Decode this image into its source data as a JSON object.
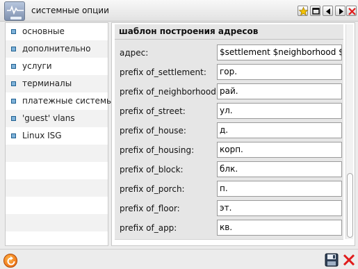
{
  "window": {
    "title": "системные опции"
  },
  "titlebar_buttons": [
    {
      "name": "favorite-star-button",
      "icon": "star-icon"
    },
    {
      "name": "maximize-button",
      "icon": "maximize-icon"
    },
    {
      "name": "previous-button",
      "icon": "arrow-left-icon"
    },
    {
      "name": "next-button",
      "icon": "arrow-right-icon"
    },
    {
      "name": "close-window-button",
      "icon": "close-icon"
    }
  ],
  "nav": {
    "items": [
      {
        "label": "основные"
      },
      {
        "label": "дополнительно"
      },
      {
        "label": "услуги"
      },
      {
        "label": "терминалы"
      },
      {
        "label": "платежные системы"
      },
      {
        "label": "'guest' vlans"
      },
      {
        "label": "Linux ISG"
      }
    ]
  },
  "section": {
    "title": "шаблон построения адресов"
  },
  "fields": [
    {
      "label": "адрес:",
      "value": "$settlement $neighborhood $lan"
    },
    {
      "label": "prefix of_settlement:",
      "value": "гор."
    },
    {
      "label": "prefix of_neighborhood:",
      "value": "рай."
    },
    {
      "label": "prefix of_street:",
      "value": "ул."
    },
    {
      "label": "prefix of_house:",
      "value": "д."
    },
    {
      "label": "prefix of_housing:",
      "value": "корп."
    },
    {
      "label": "prefix of_block:",
      "value": "блк."
    },
    {
      "label": "prefix of_porch:",
      "value": "п."
    },
    {
      "label": "prefix of_floor:",
      "value": "эт."
    },
    {
      "label": "prefix of_app:",
      "value": "кв."
    }
  ],
  "colors": {
    "accent_star": "#f5c400",
    "close_red": "#e01b1b",
    "refresh_orange": "#e8600a",
    "nav_bullet": "#7fb2d9"
  }
}
